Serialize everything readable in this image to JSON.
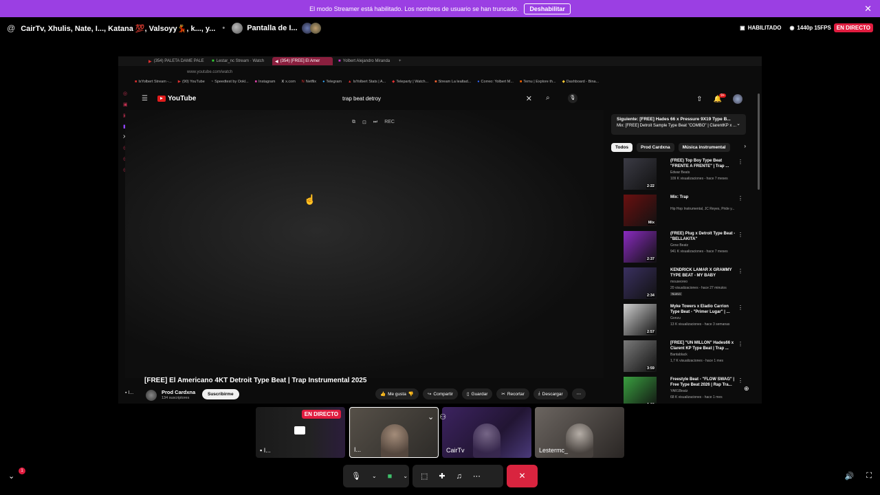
{
  "banner": {
    "text": "El modo Streamer está habilitado. Los nombres de usuario se han truncado.",
    "button": "Deshabilitar",
    "close": "✕"
  },
  "topbar": {
    "at": "@",
    "participants": "CairTv, Xhulis, Nate, I..., Katana 💯, Valsoyy💃, k..., y...",
    "separator": "•",
    "screen": "Pantalla de I...",
    "habilitado": "HABILITADO",
    "quality": "1440p 15FPS",
    "live": "EN DIRECTO"
  },
  "browser": {
    "tabs": [
      {
        "label": "(354) PALETA DAME PALE",
        "active": false
      },
      {
        "label": "Lestar_nc Stream · Watch",
        "active": false
      },
      {
        "label": "(354) [FREE] El Amer",
        "active": true
      },
      {
        "label": "Yolbert Alejandro Miranda",
        "active": false
      }
    ],
    "url": "www.youtube.com/watch",
    "bookmarks": [
      "IsYolbert Stream -...",
      "(90) YouTube",
      "Speedtest by Ookl...",
      "Instagram",
      "x.com",
      "Netflix",
      "Telegram",
      "IsYolbert Stats | A...",
      "Teleparty | Watch...",
      "Stream La lealtad...",
      "Correo: Yolbert M...",
      "Temu | Explore th...",
      "Dashboard - Bina..."
    ]
  },
  "youtube": {
    "logo": "YouTube",
    "search_value": "trap beat detroy",
    "notif_count": "9+",
    "video_controls": [
      "⧉",
      "⊡",
      "⏭",
      "REC"
    ],
    "video_title": "[FREE] El Americano 4KT Detroit Type Beat | Trap Instrumental 2025",
    "channel": {
      "name": "Prod Cardxna",
      "subs": "134 suscriptores",
      "subscribe": "Suscribirme",
      "tag": "I..."
    },
    "actions": [
      "Me gusta",
      "Compartir",
      "Guardar",
      "Recortar",
      "Descargar"
    ],
    "next": {
      "title": "Siguiente: [FREE] Hades 66 x Pressure 9X19 Type B...",
      "sub": "Mix: [FREE] Detroit Sample Type Beat \"COMBO\" | ClarentKP x ..."
    },
    "chips": [
      "Todos",
      "Prod Cardxna",
      "Música instrumental"
    ],
    "recommendations": [
      {
        "title": "(FREE) Top Boy Type Beat \"FRENTE A FRENTE\" | Trap ...",
        "channel": "Edwar Beats",
        "views": "109 K visualizaciones - hace 7 meses",
        "duration": "2:22",
        "badge": "",
        "color": "#3b3b45"
      },
      {
        "title": "Mix: Trap",
        "channel": "Hip Hop Instrumental, JC Reyes, Pride y...",
        "views": "",
        "duration": "Mix",
        "badge": "",
        "color": "#6a1010"
      },
      {
        "title": "(FREE) Plug x Detroit Type Beat - \"BELLAKITA\"",
        "channel": "Grow Beatz",
        "views": "941 K visualizaciones - hace 7 meses",
        "duration": "2:37",
        "badge": "",
        "color": "#8a2bc0"
      },
      {
        "title": "KENDRICK LAMAR X GRAMMY TYPE BEAT - MY BABY",
        "channel": "mouseoreo",
        "views": "20 visualizaciones - hace 27 minutos",
        "duration": "2:34",
        "badge": "Nuevo",
        "color": "#3a3060"
      },
      {
        "title": "Myke Towers x Eladio Carrion Type Beat - \"Primer Lugar\" | ...",
        "channel": "Gonzu",
        "views": "13 K visualizaciones - hace 3 semanas",
        "duration": "2:57",
        "badge": "",
        "color": "#cfcfcf"
      },
      {
        "title": "[FREE] \"UN MILLON\" Hades66 x Clarent KP Type Beat | Trap ...",
        "channel": "Bantablack",
        "views": "1,7 K visualizaciones - hace 1 mes",
        "duration": "3:59",
        "badge": "",
        "color": "#7a7a7a"
      },
      {
        "title": "Freestyle Beat - \"FLOW SWAG\" | Free Type Beat 2026 | Rap Tra...",
        "channel": "YAR1Beatz",
        "views": "68 K visualizaciones - hace 1 mes",
        "duration": "9:06",
        "badge": "",
        "color": "#3aa040"
      }
    ]
  },
  "call": {
    "tiles": [
      {
        "label": "I...",
        "live": "EN DIRECTO"
      },
      {
        "label": "I..."
      },
      {
        "label": "CairTv"
      },
      {
        "label": "Lestermc_"
      }
    ],
    "notif": "1"
  }
}
